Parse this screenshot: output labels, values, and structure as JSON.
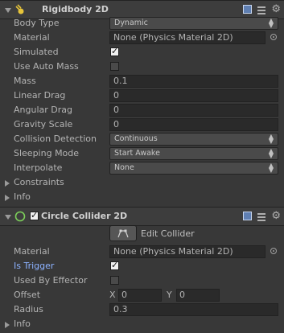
{
  "rigidbody": {
    "title": "Rigidbody 2D",
    "rows": {
      "body_type": {
        "label": "Body Type",
        "value": "Dynamic"
      },
      "material": {
        "label": "Material",
        "value": "None (Physics Material 2D)"
      },
      "simulated": {
        "label": "Simulated",
        "checked": true
      },
      "use_auto_mass": {
        "label": "Use Auto Mass",
        "checked": false
      },
      "mass": {
        "label": "Mass",
        "value": "0.1"
      },
      "linear_drag": {
        "label": "Linear Drag",
        "value": "0"
      },
      "angular_drag": {
        "label": "Angular Drag",
        "value": "0"
      },
      "gravity_scale": {
        "label": "Gravity Scale",
        "value": "0"
      },
      "collision_detection": {
        "label": "Collision Detection",
        "value": "Continuous"
      },
      "sleeping_mode": {
        "label": "Sleeping Mode",
        "value": "Start Awake"
      },
      "interpolate": {
        "label": "Interpolate",
        "value": "None"
      },
      "constraints": {
        "label": "Constraints"
      },
      "info": {
        "label": "Info"
      }
    }
  },
  "collider": {
    "title": "Circle Collider 2D",
    "edit_collider_label": "Edit Collider",
    "rows": {
      "material": {
        "label": "Material",
        "value": "None (Physics Material 2D)"
      },
      "is_trigger": {
        "label": "Is Trigger",
        "checked": true
      },
      "used_by_effector": {
        "label": "Used By Effector",
        "checked": false
      },
      "offset": {
        "label": "Offset",
        "x_label": "X",
        "x": "0",
        "y_label": "Y",
        "y": "0"
      },
      "radius": {
        "label": "Radius",
        "value": "0.3"
      },
      "info": {
        "label": "Info"
      }
    }
  },
  "colors": {
    "accent_label": "#8cb2ff",
    "background": "#383838",
    "header": "#3d3d3d"
  },
  "icons": [
    "rigidbody-icon",
    "circle-collider-icon",
    "help-book-icon",
    "preset-sliders-icon",
    "gear-icon",
    "object-picker-icon",
    "edit-collider-icon"
  ]
}
